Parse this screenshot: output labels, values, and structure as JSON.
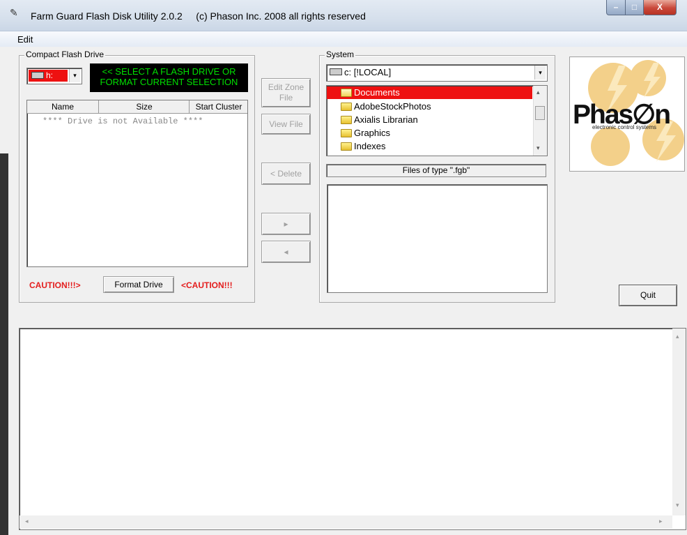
{
  "window": {
    "title": "Farm Guard Flash Disk Utility 2.0.2",
    "copyright": "(c) Phason Inc. 2008 all rights reserved",
    "min_glyph": "–",
    "max_glyph": "□",
    "close_glyph": "X"
  },
  "menu": {
    "edit": "Edit"
  },
  "compact_flash": {
    "group_label": "Compact Flash Drive",
    "drive_value": "h:",
    "lcd_line1": "<< SELECT A FLASH DRIVE OR",
    "lcd_line2": "FORMAT CURRENT SELECTION",
    "columns": [
      "Name",
      "Size",
      "Start Cluster"
    ],
    "empty_message": "**** Drive is not Available ****",
    "caution_left": "CAUTION!!!>",
    "format_button": "Format Drive",
    "caution_right": "<CAUTION!!!"
  },
  "middle_buttons": {
    "edit_zone_line1": "Edit Zone",
    "edit_zone_line2": "File",
    "view_file": "View File",
    "delete": "< Delete",
    "move_right": "▸",
    "move_left": "◂"
  },
  "system": {
    "group_label": "System",
    "drive_value": "c: [!LOCAL]",
    "folders": [
      "Documents",
      "AdobeStockPhotos",
      "Axialis Librarian",
      "Graphics",
      "Indexes"
    ],
    "selected_index": 0,
    "filter_label": "Files of type \".fgb\""
  },
  "logo": {
    "brand": "Phas∅n",
    "tagline": "electronic control systems"
  },
  "quit_button": "Quit",
  "scroll_glyphs": {
    "up": "▴",
    "down": "▾",
    "left": "◂",
    "right": "▸"
  },
  "colors": {
    "lcd_bg": "#000000",
    "lcd_text": "#00e000",
    "selected": "#ee1111",
    "caution": "#e41d1d"
  }
}
